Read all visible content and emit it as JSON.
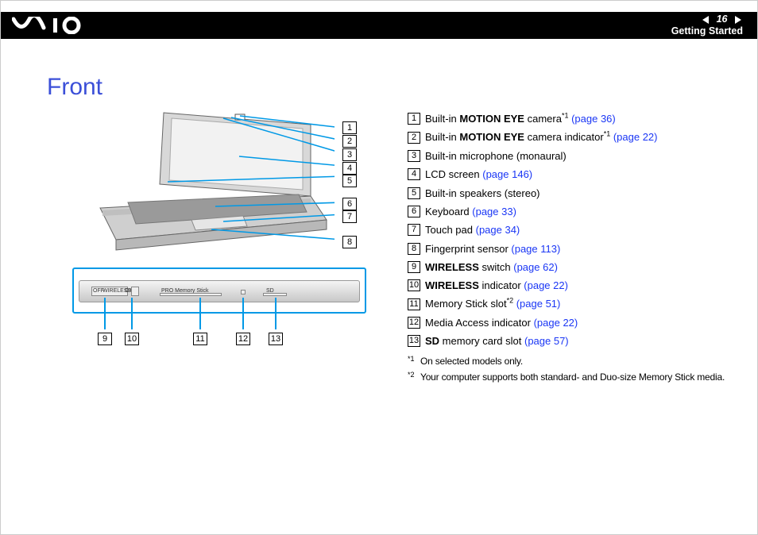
{
  "header": {
    "page_number": "16",
    "section": "Getting Started"
  },
  "title": "Front",
  "legend": [
    {
      "num": "1",
      "pre": "Built-in ",
      "bold": "MOTION EYE",
      "post": " camera",
      "sup": "*1",
      "link": "(page 36)"
    },
    {
      "num": "2",
      "pre": "Built-in ",
      "bold": "MOTION EYE",
      "post": " camera indicator",
      "sup": "*1",
      "link": "(page 22)"
    },
    {
      "num": "3",
      "pre": "Built-in microphone (monaural)",
      "bold": "",
      "post": "",
      "sup": "",
      "link": ""
    },
    {
      "num": "4",
      "pre": "LCD screen ",
      "bold": "",
      "post": "",
      "sup": "",
      "link": "(page 146)"
    },
    {
      "num": "5",
      "pre": "Built-in speakers (stereo)",
      "bold": "",
      "post": "",
      "sup": "",
      "link": ""
    },
    {
      "num": "6",
      "pre": "Keyboard ",
      "bold": "",
      "post": "",
      "sup": "",
      "link": "(page 33)"
    },
    {
      "num": "7",
      "pre": "Touch pad ",
      "bold": "",
      "post": "",
      "sup": "",
      "link": "(page 34)"
    },
    {
      "num": "8",
      "pre": "Fingerprint sensor ",
      "bold": "",
      "post": "",
      "sup": "",
      "link": "(page 113)"
    },
    {
      "num": "9",
      "pre": "",
      "bold": "WIRELESS",
      "post": " switch ",
      "sup": "",
      "link": "(page 62)"
    },
    {
      "num": "10",
      "pre": "",
      "bold": "WIRELESS",
      "post": " indicator ",
      "sup": "",
      "link": "(page 22)"
    },
    {
      "num": "11",
      "pre": "Memory Stick slot",
      "bold": "",
      "post": "",
      "sup": "*2",
      "link": " (page 51)"
    },
    {
      "num": "12",
      "pre": "Media Access indicator ",
      "bold": "",
      "post": "",
      "sup": "",
      "link": "(page 22)"
    },
    {
      "num": "13",
      "pre": "",
      "bold": "SD",
      "post": " memory card slot ",
      "sup": "",
      "link": "(page 57)"
    }
  ],
  "footnotes": [
    {
      "mark": "*1",
      "text": "On selected models only."
    },
    {
      "mark": "*2",
      "text": "Your computer supports both standard- and Duo-size Memory Stick media."
    }
  ],
  "panel_labels": {
    "off": "OFF",
    "wireless": "WIRELESS",
    "on": "ON",
    "ms": "PRO  Memory Stick",
    "sd": "SD"
  },
  "callouts_right": [
    "1",
    "2",
    "3",
    "4",
    "5",
    "6",
    "7",
    "8"
  ],
  "callouts_bottom": [
    "9",
    "10",
    "11",
    "12",
    "13"
  ]
}
